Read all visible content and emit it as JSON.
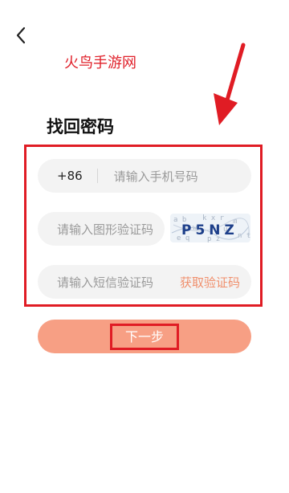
{
  "nav": {
    "back_icon": "back-chevron-icon"
  },
  "watermark_text": "火鸟手游网",
  "page_title": "找回密码",
  "phone": {
    "country_code": "+86",
    "placeholder": "请输入手机号码"
  },
  "captcha": {
    "placeholder": "请输入图形验证码",
    "image_text": "P5NZ"
  },
  "sms": {
    "placeholder": "请输入短信验证码",
    "get_code_label": "获取验证码"
  },
  "next_label": "下一步",
  "colors": {
    "accent": "#f79f84",
    "link": "#f08f6c",
    "highlight_red": "#e01c24",
    "field_bg": "#f3f3f3"
  }
}
